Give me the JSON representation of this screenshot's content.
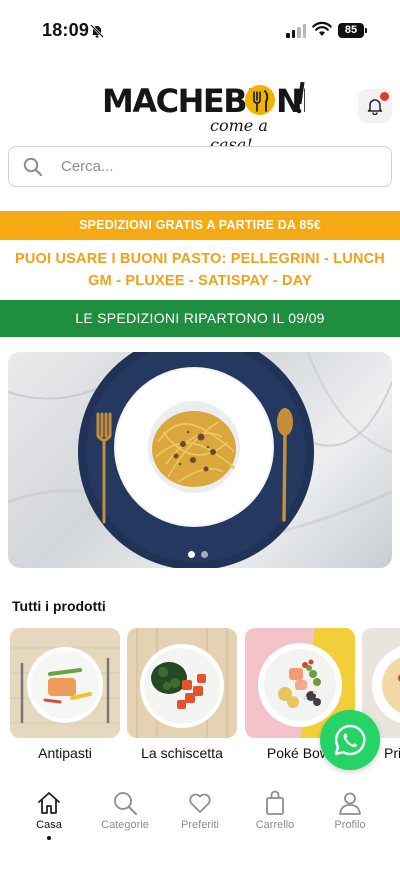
{
  "status": {
    "time": "18:09",
    "battery": "85"
  },
  "header": {
    "logo_main": "MACHEBUONI",
    "logo_sub": "come a casa!"
  },
  "search": {
    "placeholder": "Cerca..."
  },
  "banners": {
    "shipping": "SPEDIZIONI GRATIS A PARTIRE DA 85€",
    "vouchers": "PUOI USARE I BUONI PASTO: PELLEGRINI - LUNCH GM - PLUXEE - SATISPAY - DAY",
    "restart": "LE SPEDIZIONI RIPARTONO IL 09/09"
  },
  "carousel": {
    "pages": 2,
    "active": 0
  },
  "products": {
    "title": "Tutti i prodotti",
    "categories": [
      {
        "label": "Antipasti"
      },
      {
        "label": "La schiscetta"
      },
      {
        "label": "Poké Bowl"
      },
      {
        "label": "Pri"
      }
    ]
  },
  "tabs": [
    {
      "label": "Casa",
      "icon": "home-icon",
      "active": true
    },
    {
      "label": "Categorie",
      "icon": "search-icon",
      "active": false
    },
    {
      "label": "Preferiti",
      "icon": "heart-icon",
      "active": false
    },
    {
      "label": "Carrello",
      "icon": "bag-icon",
      "active": false
    },
    {
      "label": "Profilo",
      "icon": "user-icon",
      "active": false
    }
  ],
  "colors": {
    "orange": "#f5a912",
    "green": "#1f8e3f",
    "whatsapp": "#25d366",
    "alert": "#e53935"
  }
}
